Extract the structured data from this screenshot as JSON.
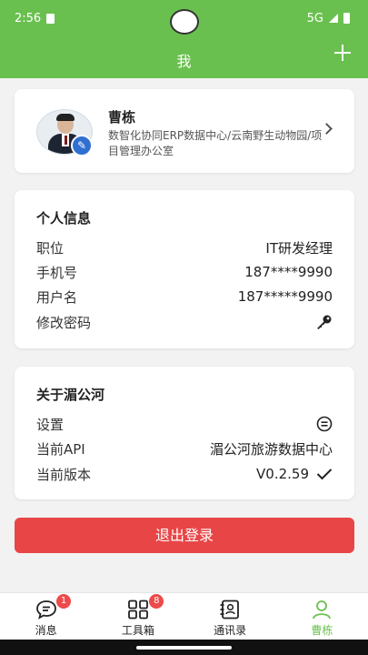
{
  "status_bar": {
    "time": "2:56",
    "network": "5G"
  },
  "header": {
    "title": "我"
  },
  "profile": {
    "name": "曹栋",
    "department": "数智化协同ERP数据中心/云南野生动物园/项目管理办公室"
  },
  "personal_info": {
    "title": "个人信息",
    "rows": [
      {
        "label": "职位",
        "value": "IT研发经理"
      },
      {
        "label": "手机号",
        "value": "187****9990"
      },
      {
        "label": "用户名",
        "value": "187*****9990"
      },
      {
        "label": "修改密码",
        "value": ""
      }
    ]
  },
  "about": {
    "title": "关于湄公河",
    "rows": [
      {
        "label": "设置",
        "value": ""
      },
      {
        "label": "当前API",
        "value": "湄公河旅游数据中心"
      },
      {
        "label": "当前版本",
        "value": "V0.2.59"
      }
    ]
  },
  "logout": {
    "label": "退出登录"
  },
  "tabs": [
    {
      "label": "消息",
      "badge": "1",
      "icon": "chat-icon"
    },
    {
      "label": "工具箱",
      "badge": "8",
      "icon": "grid-icon"
    },
    {
      "label": "通讯录",
      "badge": "",
      "icon": "contacts-icon"
    },
    {
      "label": "曹栋",
      "badge": "",
      "icon": "person-icon",
      "active": true
    }
  ],
  "colors": {
    "brand_green": "#6ac04f",
    "danger_red": "#e84646",
    "badge_red": "#ee4a4a",
    "edit_blue": "#2f6fd1"
  }
}
